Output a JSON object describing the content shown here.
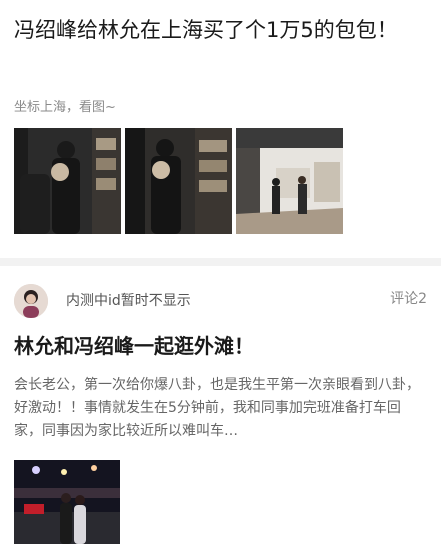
{
  "post1": {
    "title": "冯绍峰给林允在上海买了个1万5的包包！",
    "subtitle": "坐标上海，看图~"
  },
  "post2": {
    "username": "内测中id暂时不显示",
    "comments": "评论2",
    "title": "林允和冯绍峰一起逛外滩！",
    "body": "会长老公，第一次给你爆八卦，也是我生平第一次亲眼看到八卦，好激动！！事情就发生在5分钟前，我和同事加完班准备打车回家，同事因为家比较近所以难叫车…"
  }
}
